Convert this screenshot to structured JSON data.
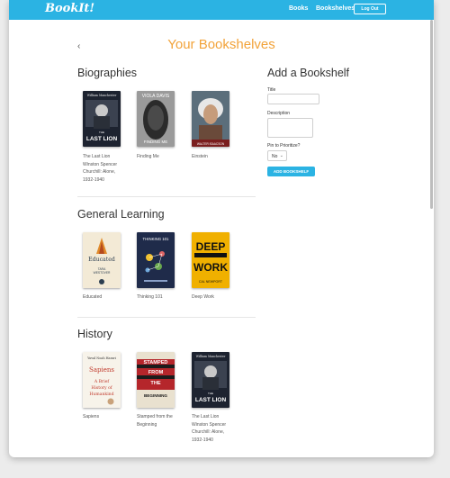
{
  "navbar": {
    "brand": "BookIt!",
    "books_link": "Books",
    "bookshelves_link": "Bookshelves",
    "logout_label": "Log Out"
  },
  "page": {
    "back_glyph": "‹",
    "title": "Your Bookshelves"
  },
  "shelves": [
    {
      "name": "Biographies",
      "books": [
        {
          "caption": "The Last Lion\nWinston Spencer\nChurchill: Alone,\n1932-1940",
          "cover_text": [
            "William Manchester",
            "THE",
            "LAST LION"
          ]
        },
        {
          "caption": "Finding Me",
          "cover_text": [
            "VIOLA DAVIS",
            "FINDING ME"
          ]
        },
        {
          "caption": "Einstein",
          "cover_text": [
            "WALTER ISAACSON"
          ]
        }
      ]
    },
    {
      "name": "General Learning",
      "books": [
        {
          "caption": "Educated",
          "cover_text": [
            "Educated",
            "TARA",
            "WESTOVER"
          ]
        },
        {
          "caption": "Thinking 101",
          "cover_text": [
            "THINKING 101"
          ]
        },
        {
          "caption": "Deep Work",
          "cover_text": [
            "DEEP",
            "WORK",
            "CAL NEWPORT"
          ]
        }
      ]
    },
    {
      "name": "History",
      "books": [
        {
          "caption": "Sapiens",
          "cover_text": [
            "Yuval Noah Harari",
            "Sapiens",
            "A Brief",
            "History of",
            "Humankind"
          ]
        },
        {
          "caption": "Stamped from the\nBeginning",
          "cover_text": [
            "STAMPED",
            "FROM",
            "THE",
            "BEGINNING"
          ]
        },
        {
          "caption": "The Last Lion\nWinston Spencer\nChurchill: Alone,\n1932-1940",
          "cover_text": [
            "William Manchester",
            "THE",
            "LAST LION"
          ]
        }
      ]
    }
  ],
  "add_form": {
    "title": "Add a Bookshelf",
    "title_label": "Title",
    "description_label": "Description",
    "pin_label": "Pin to Prioritize?",
    "pin_value": "No",
    "submit_label": "ADD BOOKSHELF"
  },
  "colors": {
    "nav": "#2bb3e3",
    "accent": "#f2a33a"
  }
}
